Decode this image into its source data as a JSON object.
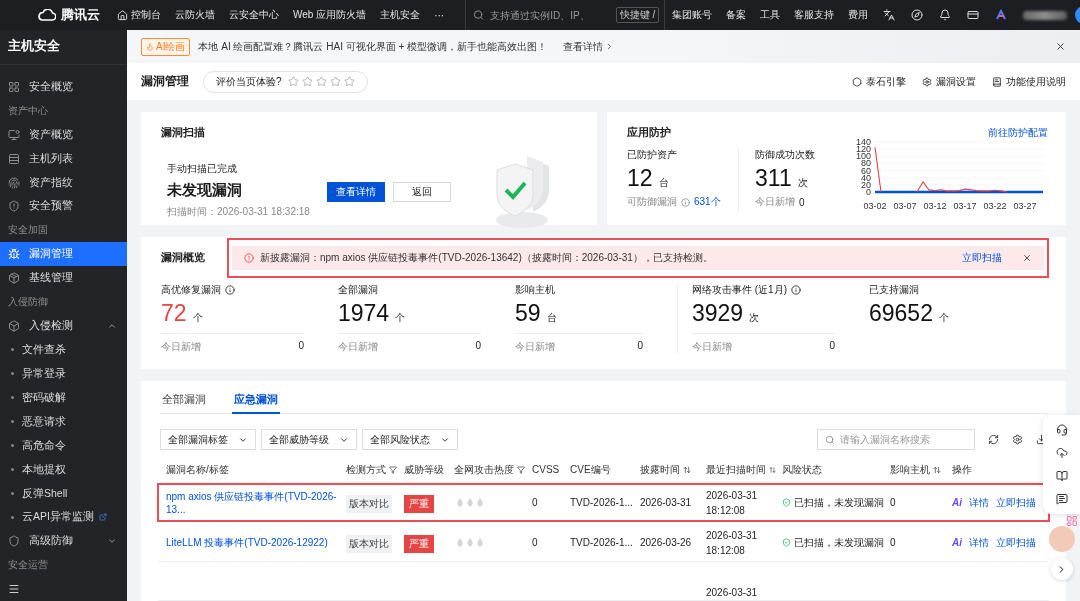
{
  "top_nav": {
    "brand": "腾讯云",
    "items": [
      {
        "kind": "home",
        "label": "控制台"
      },
      {
        "kind": "link",
        "label": "云防火墙"
      },
      {
        "kind": "link",
        "label": "云安全中心"
      },
      {
        "kind": "link",
        "label": "Web 应用防火墙"
      },
      {
        "kind": "link",
        "label": "主机安全"
      },
      {
        "kind": "more",
        "label": "···"
      }
    ],
    "search": {
      "placeholder": "支持通过实例ID、IP、",
      "shortcut": "快捷键 /"
    },
    "links": [
      "集团账号",
      "备案",
      "工具",
      "客服支持",
      "费用"
    ]
  },
  "sidebar": {
    "title": "主机安全",
    "items": [
      {
        "kind": "item",
        "label": "安全概览",
        "selected": false
      },
      {
        "kind": "section",
        "label": "资产中心"
      },
      {
        "kind": "item",
        "label": "资产概览",
        "selected": false
      },
      {
        "kind": "item",
        "label": "主机列表",
        "selected": false
      },
      {
        "kind": "item",
        "label": "资产指纹",
        "selected": false
      },
      {
        "kind": "item",
        "label": "安全预警",
        "selected": false
      },
      {
        "kind": "section",
        "label": "安全加固"
      },
      {
        "kind": "item",
        "label": "漏洞管理",
        "selected": true
      },
      {
        "kind": "item",
        "label": "基线管理",
        "selected": false
      },
      {
        "kind": "section",
        "label": "入侵防御"
      },
      {
        "kind": "group",
        "label": "入侵检测",
        "expanded": true,
        "children": [
          {
            "label": "文件查杀",
            "selected": false,
            "external": false
          },
          {
            "label": "异常登录",
            "selected": false,
            "external": false
          },
          {
            "label": "密码破解",
            "selected": false,
            "external": false
          },
          {
            "label": "恶意请求",
            "selected": false,
            "external": false
          },
          {
            "label": "高危命令",
            "selected": false,
            "external": false
          },
          {
            "label": "本地提权",
            "selected": false,
            "external": false
          },
          {
            "label": "反弹Shell",
            "selected": false,
            "external": false
          },
          {
            "label": "云API异常监测",
            "selected": false,
            "external": true
          }
        ]
      },
      {
        "kind": "group",
        "label": "高级防御",
        "expanded": false
      },
      {
        "kind": "section",
        "label": "安全运营"
      }
    ]
  },
  "banner": {
    "badge": "AI绘画",
    "text": "本地 AI 绘画配置难？腾讯云 HAI 可视化界面 + 模型微调，新手也能高效出图！",
    "link": "查看详情"
  },
  "header": {
    "title": "漏洞管理",
    "rating": {
      "label": "评价当页体验?",
      "stars": 0
    },
    "actions": [
      "泰石引擎",
      "漏洞设置",
      "功能使用说明"
    ]
  },
  "scan_card": {
    "title": "漏洞扫描",
    "status": "手动扫描已完成",
    "result": "未发现漏洞",
    "time": "扫描时间：2026-03-31 18:32:18",
    "buttons": [
      {
        "label": "查看详情",
        "primary": true
      },
      {
        "label": "返回",
        "primary": false
      }
    ]
  },
  "protection_card": {
    "title": "应用防护",
    "link": "前往防护配置",
    "assets": {
      "label": "已防护资产",
      "value": "12",
      "unit": "台",
      "sub_label": "可防御漏洞",
      "sub_value": "631个"
    },
    "defense": {
      "label": "防御成功次数",
      "value": "311",
      "unit": "次",
      "sub_label": "今日新增",
      "sub_value": "0"
    },
    "chart_data": {
      "type": "line",
      "categories": [
        "03-02",
        null,
        null,
        null,
        null,
        "03-07",
        null,
        null,
        null,
        null,
        "03-12",
        null,
        null,
        null,
        null,
        "03-17",
        null,
        null,
        null,
        null,
        "03-22",
        null,
        null,
        null,
        null,
        "03-27",
        null,
        null,
        null
      ],
      "ylim": [
        0,
        140
      ],
      "yticks": [
        0,
        20,
        40,
        60,
        80,
        100,
        120,
        140
      ],
      "grid": true,
      "series": [
        {
          "color": "#0052d9",
          "values": [
            0,
            0,
            0,
            0,
            0,
            0,
            0,
            0,
            0,
            0,
            0,
            0,
            0,
            0,
            0,
            0,
            0,
            0,
            0,
            0,
            0,
            0,
            0,
            0,
            0,
            0,
            0,
            0,
            0
          ]
        },
        {
          "color": "#e54545",
          "values": [
            125,
            0,
            null,
            null,
            null,
            null,
            null,
            0,
            28,
            6,
            4,
            6,
            3,
            3,
            4,
            8,
            6,
            4,
            3,
            3,
            5,
            3,
            0,
            null,
            null,
            null,
            null,
            null,
            null
          ]
        }
      ]
    }
  },
  "overview": {
    "title": "漏洞概览",
    "alert": {
      "text": "新披露漏洞：npm axios 供应链投毒事件(TVD-2026-13642)（披露时间：2026-03-31），已支持检测。",
      "link": "立即扫描",
      "highlighted": true
    },
    "stats": [
      {
        "label": "高优修复漏洞",
        "info": true,
        "value": "72",
        "unit": "个",
        "emphasis": true,
        "footer": {
          "label": "今日新增",
          "value": "0"
        }
      },
      {
        "label": "全部漏洞",
        "info": false,
        "value": "1974",
        "unit": "个",
        "emphasis": false,
        "footer": {
          "label": "今日新增",
          "value": "0"
        }
      },
      {
        "label": "影响主机",
        "info": false,
        "value": "59",
        "unit": "台",
        "emphasis": false,
        "footer": {
          "label": "今日新增",
          "value": "0"
        }
      },
      {
        "label": "网络攻击事件 (近1月)",
        "info": true,
        "value": "3929",
        "unit": "次",
        "emphasis": false,
        "footer": {
          "label": "今日新增",
          "value": "0"
        }
      },
      {
        "label": "已支持漏洞",
        "info": false,
        "value": "69652",
        "unit": "个",
        "emphasis": false
      }
    ]
  },
  "table": {
    "tabs": [
      {
        "label": "全部漏洞",
        "selected": false
      },
      {
        "label": "应急漏洞",
        "selected": true
      }
    ],
    "filters": [
      "全部漏洞标签",
      "全部威胁等级",
      "全部风险状态"
    ],
    "search": {
      "placeholder": "请输入漏洞名称搜索"
    },
    "columns": [
      {
        "label": "漏洞名称/标签",
        "kind": "plain"
      },
      {
        "label": "检测方式",
        "kind": "filter"
      },
      {
        "label": "威胁等级",
        "kind": "plain"
      },
      {
        "label": "全网攻击热度",
        "kind": "filter"
      },
      {
        "label": "CVSS",
        "kind": "plain"
      },
      {
        "label": "CVE编号",
        "kind": "plain"
      },
      {
        "label": "披露时间",
        "kind": "sort"
      },
      {
        "label": "最近扫描时间",
        "kind": "sort"
      },
      {
        "label": "风险状态",
        "kind": "plain"
      },
      {
        "label": "影响主机",
        "kind": "sort"
      },
      {
        "label": "操作",
        "kind": "plain"
      }
    ],
    "rows": [
      {
        "name": "npm axios 供应链投毒事件(TVD-2026-13...",
        "method": "版本对比",
        "threat": "严重",
        "cvss": "0",
        "cve": "TVD-2026-1...",
        "disclosed": "2026-03-31",
        "last_scan": [
          "2026-03-31",
          "18:12:08"
        ],
        "status": "已扫描，未发现漏洞",
        "hosts": "0",
        "actions": [
          {
            "kind": "ai",
            "label": "Ai"
          },
          {
            "kind": "link",
            "label": "详情"
          },
          {
            "kind": "link",
            "label": "立即扫描"
          }
        ],
        "highlighted": true
      },
      {
        "name": "LiteLLM 投毒事件(TVD-2026-12922)",
        "method": "版本对比",
        "threat": "严重",
        "cvss": "0",
        "cve": "TVD-2026-1...",
        "disclosed": "2026-03-26",
        "last_scan": [
          "2026-03-31",
          "18:12:08"
        ],
        "status": "已扫描，未发现漏洞",
        "hosts": "0",
        "actions": [
          {
            "kind": "ai",
            "label": "Ai"
          },
          {
            "kind": "link",
            "label": "详情"
          },
          {
            "kind": "link",
            "label": "立即扫描"
          }
        ],
        "highlighted": false
      },
      {
        "last_scan": [
          "2026-03-31"
        ],
        "highlighted": false
      }
    ]
  }
}
